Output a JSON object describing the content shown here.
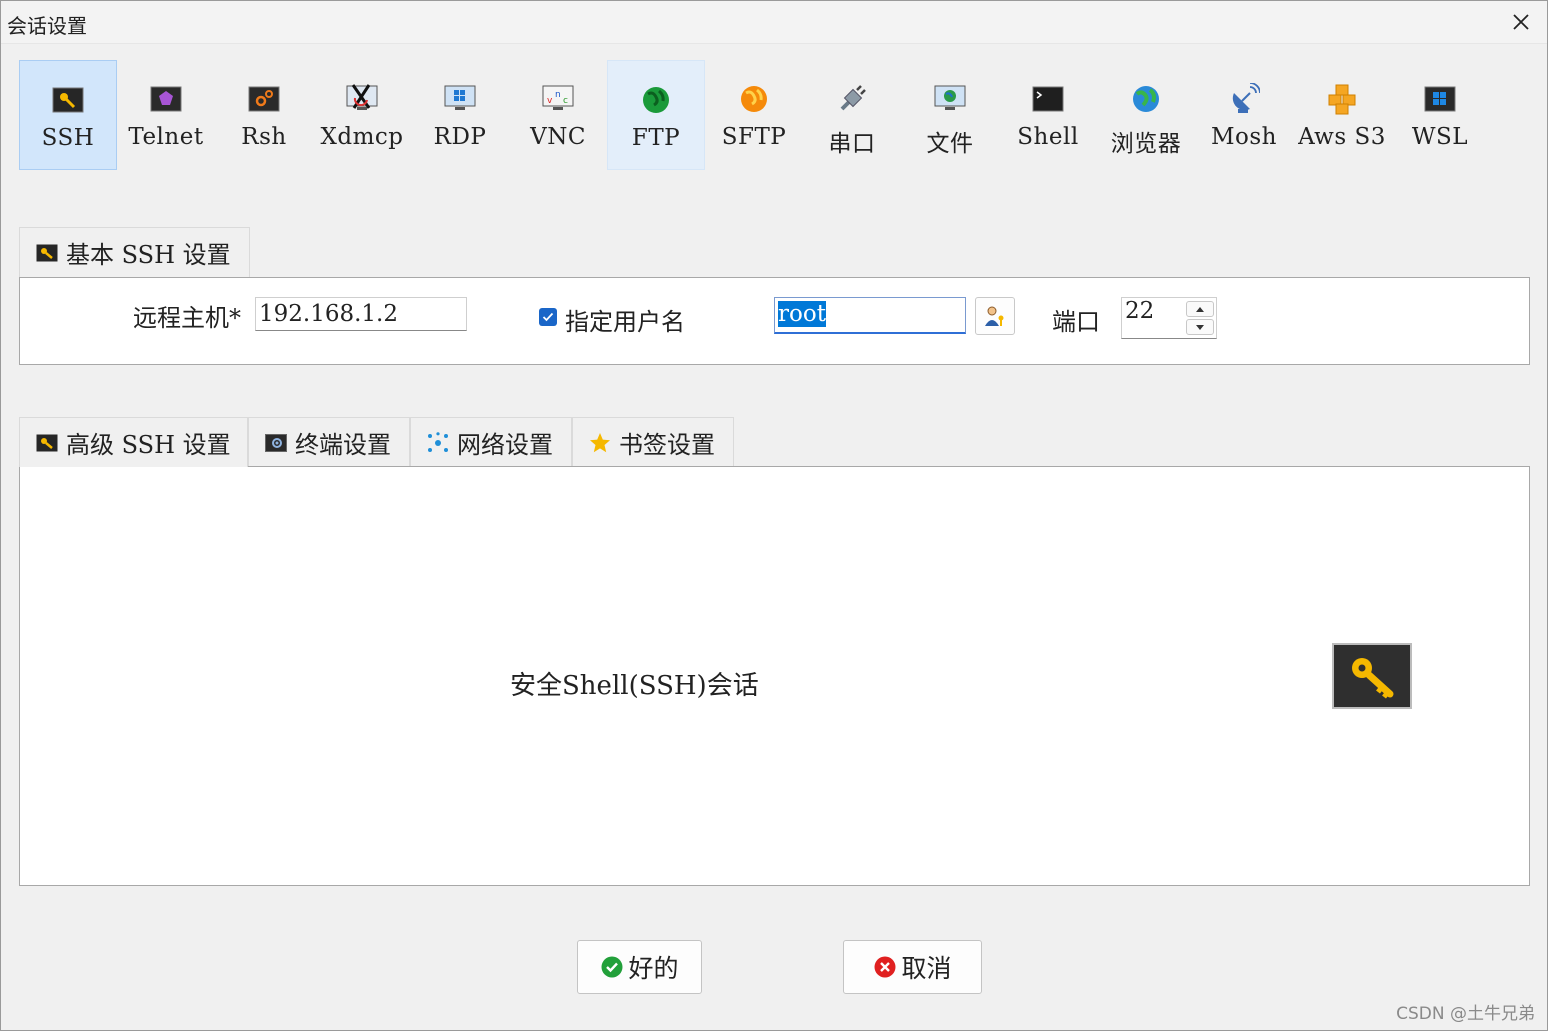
{
  "window": {
    "title": "会话设置"
  },
  "session_types": [
    {
      "label": "SSH",
      "icon": "ssh-key-icon",
      "selected": true
    },
    {
      "label": "Telnet",
      "icon": "telnet-icon"
    },
    {
      "label": "Rsh",
      "icon": "rsh-icon"
    },
    {
      "label": "Xdmcp",
      "icon": "xdmcp-icon"
    },
    {
      "label": "RDP",
      "icon": "rdp-icon"
    },
    {
      "label": "VNC",
      "icon": "vnc-icon"
    },
    {
      "label": "FTP",
      "icon": "ftp-globe-icon",
      "hovered": true
    },
    {
      "label": "SFTP",
      "icon": "sftp-globe-icon"
    },
    {
      "label": "串口",
      "icon": "serial-plug-icon"
    },
    {
      "label": "文件",
      "icon": "file-monitor-icon"
    },
    {
      "label": "Shell",
      "icon": "shell-terminal-icon"
    },
    {
      "label": "浏览器",
      "icon": "browser-globe-icon"
    },
    {
      "label": "Mosh",
      "icon": "mosh-satellite-icon"
    },
    {
      "label": "Aws S3",
      "icon": "aws-cubes-icon"
    },
    {
      "label": "WSL",
      "icon": "wsl-windows-icon"
    }
  ],
  "basic": {
    "tab_label": "基本 SSH 设置",
    "remote_host_label": "远程主机*",
    "remote_host_value": "192.168.1.2",
    "specify_user_label": "指定用户名",
    "specify_user_checked": true,
    "username_value": "root",
    "port_label": "端口",
    "port_value": "22"
  },
  "advanced_tabs": [
    {
      "label": "高级 SSH 设置",
      "icon": "ssh-key-icon"
    },
    {
      "label": "终端设置",
      "icon": "terminal-settings-icon"
    },
    {
      "label": "网络设置",
      "icon": "network-icon"
    },
    {
      "label": "书签设置",
      "icon": "star-icon"
    }
  ],
  "panel": {
    "description": "安全Shell(SSH)会话",
    "icon": "key-icon"
  },
  "buttons": {
    "ok": "好的",
    "cancel": "取消"
  },
  "watermark": "CSDN @土牛兄弟"
}
